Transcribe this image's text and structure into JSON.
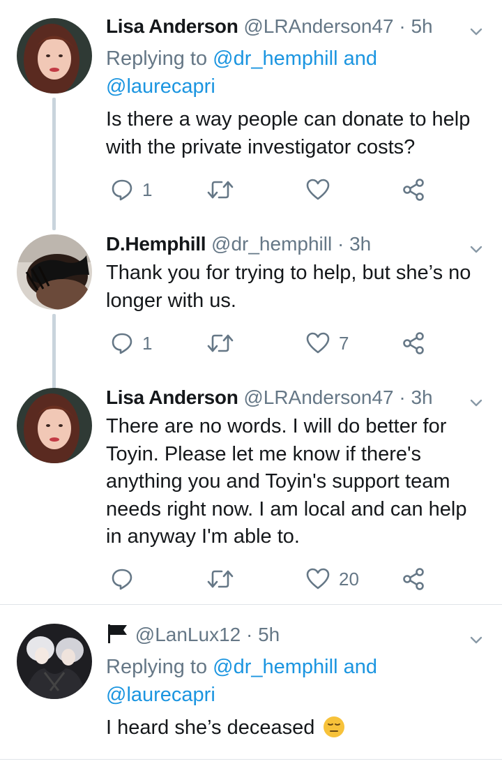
{
  "tweets": [
    {
      "name": "Lisa Anderson",
      "handle": "@LRAnderson47",
      "time": "5h",
      "reply_prefix": "Replying to",
      "reply_mention_1": "@dr_hemphill",
      "reply_and": "and",
      "reply_mention_2": "@laurecapri",
      "line1": "Is there a way people can donate to help",
      "line2": "with the private investigator costs?",
      "reply_count": "1",
      "like_count": ""
    },
    {
      "name": "D.Hemphill",
      "handle": "@dr_hemphill",
      "time": "3h",
      "line1": "Thank you for trying to help, but she’s no",
      "line2": "longer with us.",
      "reply_count": "1",
      "like_count": "7"
    },
    {
      "name": "Lisa Anderson",
      "handle": "@LRAnderson47",
      "time": "3h",
      "line1": "There are no words. I will do better for",
      "line2": "Toyin. Please let me know if there's",
      "line3": "anything you and Toyin's support team",
      "line4": "needs right now. I am local and can help",
      "line5": "in anyway I'm able to.",
      "reply_count": "",
      "like_count": "20"
    },
    {
      "name": "",
      "handle": "@LanLux12",
      "time": "5h",
      "reply_prefix": "Replying to",
      "reply_mention_1": "@dr_hemphill",
      "reply_and": "and",
      "reply_mention_2": "@laurecapri",
      "line1": "I heard she’s deceased"
    }
  ],
  "separator": "·",
  "icons": {
    "reply": "reply-icon",
    "retweet": "retweet-icon",
    "like": "heart-icon",
    "share": "share-icon",
    "caret": "chevron-down-icon",
    "flag": "flag-icon",
    "emoji": "expressionless-face-emoji"
  },
  "colors": {
    "link": "#1b95e0",
    "muted": "#657786",
    "thread_line": "#c9d4dc"
  }
}
